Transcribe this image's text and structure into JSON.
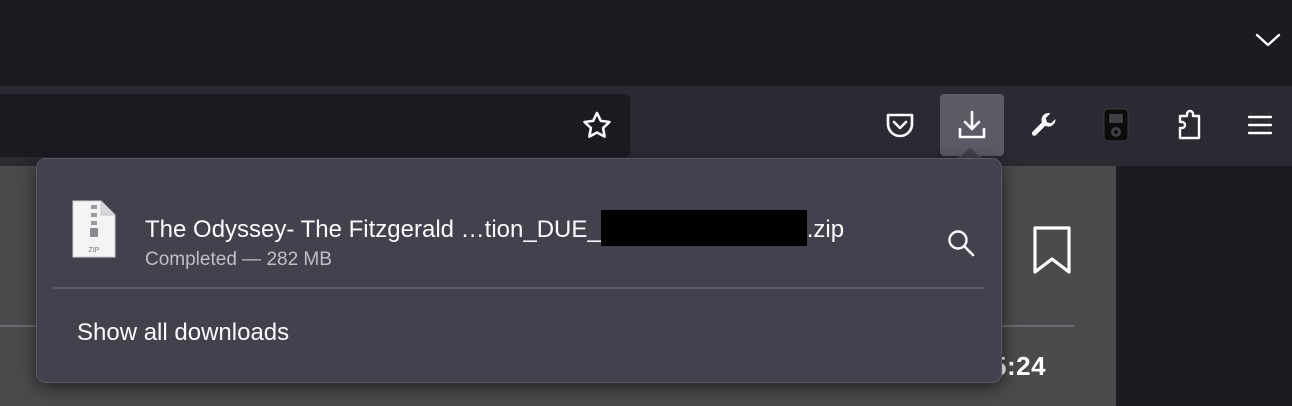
{
  "toolbar": {
    "buttons": [
      {
        "name": "pocket-icon"
      },
      {
        "name": "download-icon",
        "active": true
      },
      {
        "name": "wrench-icon"
      },
      {
        "name": "music-player-icon"
      },
      {
        "name": "extensions-icon"
      },
      {
        "name": "hamburger-menu-icon"
      }
    ],
    "tab_list_icon": "chevron-down-icon",
    "bookmark_star_icon": "star-icon"
  },
  "downloads_panel": {
    "item": {
      "name_prefix": "The Odyssey- The Fitzgerald …tion_DUE_",
      "name_suffix": ".zip",
      "file_type_label": "ZIP",
      "status": "Completed — 282 MB"
    },
    "show_all_label": "Show all downloads"
  },
  "page": {
    "bookmark_icon": "bookmark-icon",
    "time": "5:24"
  },
  "colors": {
    "toolbar_bg": "#2b2a33",
    "tabstrip_bg": "#1c1b22",
    "panel_bg": "#42414d",
    "active_button_bg": "#5b5b66",
    "text": "#fbfbfe"
  }
}
